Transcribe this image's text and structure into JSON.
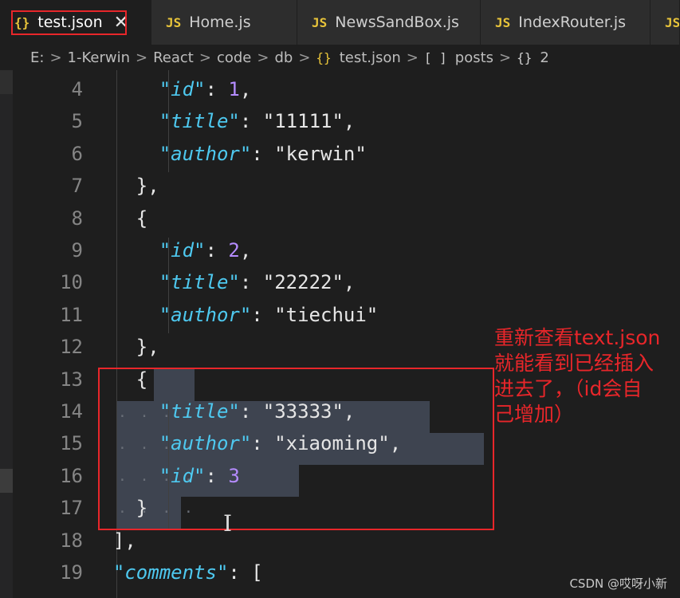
{
  "tabs": [
    {
      "icon": "{}",
      "label": "test.json",
      "active": true,
      "close": "✕"
    },
    {
      "icon": "JS",
      "label": "Home.js"
    },
    {
      "icon": "JS",
      "label": "NewsSandBox.js"
    },
    {
      "icon": "JS",
      "label": "IndexRouter.js"
    },
    {
      "icon": "JS",
      "label": ""
    }
  ],
  "breadcrumb": {
    "drive": "E:",
    "sep": ">",
    "p1": "1-Kerwin",
    "p2": "React",
    "p3": "code",
    "p4": "db",
    "file_icon": "{}",
    "file": "test.json",
    "arr_icon": "[ ]",
    "arr": "posts",
    "obj_icon": "{}",
    "obj": "2"
  },
  "lines": [
    {
      "n": "4",
      "parts": [
        [
          "p",
          "      "
        ],
        [
          "k",
          "\"id\""
        ],
        [
          "p",
          ": "
        ],
        [
          "n",
          "1"
        ],
        [
          "p",
          ","
        ]
      ]
    },
    {
      "n": "5",
      "parts": [
        [
          "p",
          "      "
        ],
        [
          "k",
          "\"title\""
        ],
        [
          "p",
          ": "
        ],
        [
          "s",
          "\"11111\""
        ],
        [
          "p",
          ","
        ]
      ]
    },
    {
      "n": "6",
      "parts": [
        [
          "p",
          "      "
        ],
        [
          "k",
          "\"author\""
        ],
        [
          "p",
          ": "
        ],
        [
          "s",
          "\"kerwin\""
        ]
      ]
    },
    {
      "n": "7",
      "parts": [
        [
          "p",
          "    },"
        ]
      ]
    },
    {
      "n": "8",
      "parts": [
        [
          "p",
          "    {"
        ]
      ]
    },
    {
      "n": "9",
      "parts": [
        [
          "p",
          "      "
        ],
        [
          "k",
          "\"id\""
        ],
        [
          "p",
          ": "
        ],
        [
          "n",
          "2"
        ],
        [
          "p",
          ","
        ]
      ]
    },
    {
      "n": "10",
      "parts": [
        [
          "p",
          "      "
        ],
        [
          "k",
          "\"title\""
        ],
        [
          "p",
          ": "
        ],
        [
          "s",
          "\"22222\""
        ],
        [
          "p",
          ","
        ]
      ]
    },
    {
      "n": "11",
      "parts": [
        [
          "p",
          "      "
        ],
        [
          "k",
          "\"author\""
        ],
        [
          "p",
          ": "
        ],
        [
          "s",
          "\"tiechui\""
        ]
      ]
    },
    {
      "n": "12",
      "parts": [
        [
          "p",
          "    },"
        ]
      ]
    },
    {
      "n": "13",
      "parts": [
        [
          "p",
          "    {"
        ]
      ]
    },
    {
      "n": "14",
      "parts": [
        [
          "p",
          "      "
        ],
        [
          "k",
          "\"title\""
        ],
        [
          "p",
          ": "
        ],
        [
          "s",
          "\"33333\""
        ],
        [
          "p",
          ","
        ]
      ]
    },
    {
      "n": "15",
      "parts": [
        [
          "p",
          "      "
        ],
        [
          "k",
          "\"author\""
        ],
        [
          "p",
          ": "
        ],
        [
          "s",
          "\"xiaoming\""
        ],
        [
          "p",
          ","
        ]
      ]
    },
    {
      "n": "16",
      "parts": [
        [
          "p",
          "      "
        ],
        [
          "k",
          "\"id\""
        ],
        [
          "p",
          ": "
        ],
        [
          "n",
          "3"
        ]
      ]
    },
    {
      "n": "17",
      "parts": [
        [
          "p",
          "    }"
        ]
      ]
    },
    {
      "n": "18",
      "parts": [
        [
          "p",
          "  ],"
        ]
      ]
    },
    {
      "n": "19",
      "parts": [
        [
          "p",
          "  "
        ],
        [
          "k",
          "\"comments\""
        ],
        [
          "p",
          ": ["
        ]
      ]
    }
  ],
  "whitespace_dots": "· · · ·",
  "annotation": {
    "line1": "重新查看text.json",
    "line2": "就能看到已经插入",
    "line3": "进去了，（id会自",
    "line4": "己增加）"
  },
  "text_cursor": "I",
  "watermark": "CSDN @哎呀小新",
  "colors": {
    "key": "#4ec9f0",
    "number": "#b58cff",
    "string": "#e6e6e6",
    "annotation_red": "#e8262a",
    "selection": "#3e4450",
    "js_icon": "#e8c43a"
  }
}
